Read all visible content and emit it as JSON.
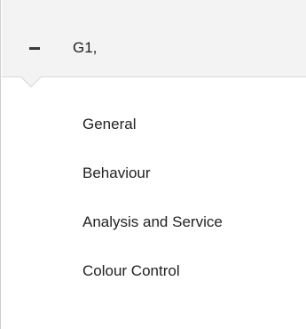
{
  "group": {
    "title": "G1,",
    "icon": "collapse-icon"
  },
  "menu": {
    "items": [
      {
        "label": "General"
      },
      {
        "label": "Behaviour"
      },
      {
        "label": "Analysis and Service"
      },
      {
        "label": "Colour Control"
      }
    ]
  }
}
